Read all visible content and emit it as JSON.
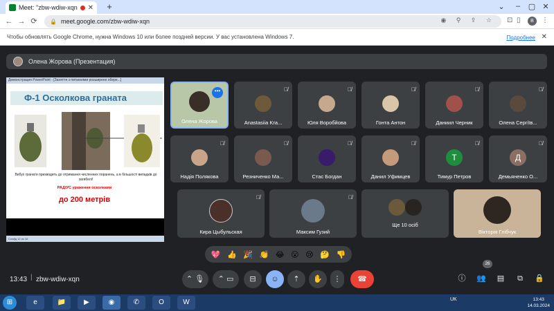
{
  "browser": {
    "tab_title": "Meet: \"zbw-wdiw-xqn\"",
    "url": "meet.google.com/zbw-wdiw-xqn",
    "profile_initial": "B",
    "infobar_text": "Чтобы обновлять Google Chrome, нужна Windows 10 или более поздней версии. У вас установлена Windows 7.",
    "infobar_link": "Подробнее"
  },
  "meeting": {
    "presenter_label": "Олена Жорова (Презентация)",
    "time": "13:43",
    "code": "zbw-wdiw-xqn",
    "participant_count": "26"
  },
  "slide": {
    "window_title": "Демонстрация PowerPoint - [Заняття з питаннями розширене обере...]",
    "title": "Ф-1 Осколкова граната",
    "description": "Вибух гранати призводить до отримання численних поранень, а в більшості випадків до загибелі!",
    "radius_label": "РАДІУС ураження осколками",
    "distance": "до 200 метрів",
    "footer": "Слайд 12 из 16"
  },
  "participants": [
    {
      "name": "Олена Жорова"
    },
    {
      "name": "Anastasiia Kra..."
    },
    {
      "name": "Юля Воробйова"
    },
    {
      "name": "Гонта Антон"
    },
    {
      "name": "Даниил Черник"
    },
    {
      "name": "Олена Сергіїв..."
    },
    {
      "name": "Надія Полякова"
    },
    {
      "name": "Резниченко Ма..."
    },
    {
      "name": "Стас Богдан"
    },
    {
      "name": "Данил Уфимцев"
    },
    {
      "name": "Тимур Петров",
      "initial": "Т"
    },
    {
      "name": "Демьяненко О...",
      "initial": "Д"
    },
    {
      "name": "Кира Цыбульская"
    },
    {
      "name": "Максим Гузий"
    },
    {
      "name": "Ще 10 осіб"
    },
    {
      "name": "Вікторія Глібчук"
    }
  ],
  "reactions": [
    "💖",
    "👍",
    "🎉",
    "👏",
    "😂",
    "😮",
    "😢",
    "🤔",
    "👎"
  ],
  "taskbar": {
    "lang": "UK",
    "time": "13:43",
    "date": "14.03.2024"
  },
  "colors": {
    "meet_bg": "#202124",
    "tile_bg": "#3c4043",
    "hangup": "#ea4335",
    "active": "#8ab4f8"
  }
}
